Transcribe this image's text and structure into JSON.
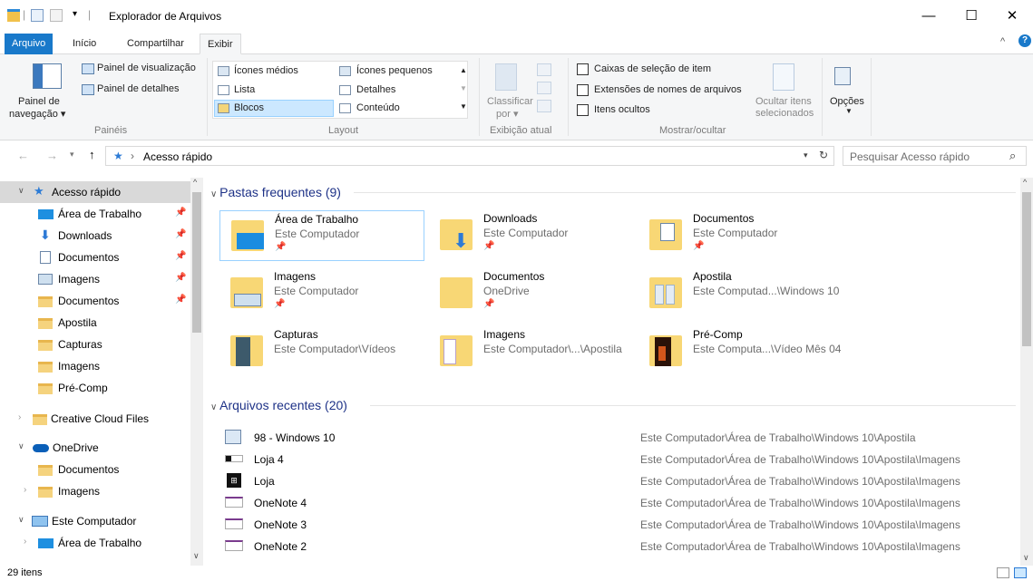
{
  "window": {
    "title": "Explorador de Arquivos",
    "minimize": "—",
    "maximize": "☐",
    "close": "✕"
  },
  "tabs": [
    "Arquivo",
    "Início",
    "Compartilhar",
    "Exibir"
  ],
  "ribbon": {
    "paineis": {
      "navegacao": "Painel de\nnavegação ▾",
      "nav_line1": "Painel de",
      "nav_line2": "navegação ▾",
      "visualizacao": "Painel de visualização",
      "detalhes": "Painel de detalhes",
      "group": "Painéis"
    },
    "layout": {
      "items": [
        "Ícones médios",
        "Ícones pequenos",
        "Lista",
        "Detalhes",
        "Blocos",
        "Conteúdo"
      ],
      "group": "Layout"
    },
    "exibicao": {
      "classificar1": "Classificar",
      "classificar2": "por ▾",
      "group": "Exibição atual"
    },
    "mostrar": {
      "caixas": "Caixas de seleção de item",
      "extensoes": "Extensões de nomes de arquivos",
      "ocultos": "Itens ocultos",
      "ocultar1": "Ocultar itens",
      "ocultar2": "selecionados",
      "group": "Mostrar/ocultar"
    },
    "opcoes": "Opções"
  },
  "address": {
    "path": "Acesso rápido",
    "search_placeholder": "Pesquisar Acesso rápido"
  },
  "nav": [
    {
      "label": "Acesso rápido",
      "pin": false
    },
    {
      "label": "Área de Trabalho",
      "pin": true
    },
    {
      "label": "Downloads",
      "pin": true
    },
    {
      "label": "Documentos",
      "pin": true
    },
    {
      "label": "Imagens",
      "pin": true
    },
    {
      "label": "Documentos",
      "pin": true
    },
    {
      "label": "Apostila",
      "pin": false
    },
    {
      "label": "Capturas",
      "pin": false
    },
    {
      "label": "Imagens",
      "pin": false
    },
    {
      "label": "Pré-Comp",
      "pin": false
    },
    {
      "label": "Creative Cloud Files",
      "pin": false
    },
    {
      "label": "OneDrive",
      "pin": false
    },
    {
      "label": "Documentos",
      "pin": false
    },
    {
      "label": "Imagens",
      "pin": false
    },
    {
      "label": "Este Computador",
      "pin": false
    },
    {
      "label": "Área de Trabalho",
      "pin": false
    }
  ],
  "main": {
    "frequent_header": "Pastas frequentes (9)",
    "frequent": [
      {
        "name": "Área de Trabalho",
        "sub": "Este Computador",
        "pin": true
      },
      {
        "name": "Downloads",
        "sub": "Este Computador",
        "pin": true
      },
      {
        "name": "Documentos",
        "sub": "Este Computador",
        "pin": true
      },
      {
        "name": "Imagens",
        "sub": "Este Computador",
        "pin": true
      },
      {
        "name": "Documentos",
        "sub": "OneDrive",
        "pin": true
      },
      {
        "name": "Apostila",
        "sub": "Este Computad...\\Windows 10",
        "pin": false
      },
      {
        "name": "Capturas",
        "sub": "Este Computador\\Vídeos",
        "pin": false
      },
      {
        "name": "Imagens",
        "sub": "Este Computador\\...\\Apostila",
        "pin": false
      },
      {
        "name": "Pré-Comp",
        "sub": "Este Computa...\\Vídeo Mês 04",
        "pin": false
      }
    ],
    "recent_header": "Arquivos recentes (20)",
    "recent": [
      {
        "name": "98 - Windows 10",
        "path": "Este Computador\\Área de Trabalho\\Windows 10\\Apostila"
      },
      {
        "name": "Loja 4",
        "path": "Este Computador\\Área de Trabalho\\Windows 10\\Apostila\\Imagens"
      },
      {
        "name": "Loja",
        "path": "Este Computador\\Área de Trabalho\\Windows 10\\Apostila\\Imagens"
      },
      {
        "name": "OneNote 4",
        "path": "Este Computador\\Área de Trabalho\\Windows 10\\Apostila\\Imagens"
      },
      {
        "name": "OneNote 3",
        "path": "Este Computador\\Área de Trabalho\\Windows 10\\Apostila\\Imagens"
      },
      {
        "name": "OneNote 2",
        "path": "Este Computador\\Área de Trabalho\\Windows 10\\Apostila\\Imagens"
      }
    ]
  },
  "status": "29 itens",
  "colors": {
    "accent": "#1979ca",
    "selection": "#cce8ff",
    "folder": "#f8d775"
  }
}
